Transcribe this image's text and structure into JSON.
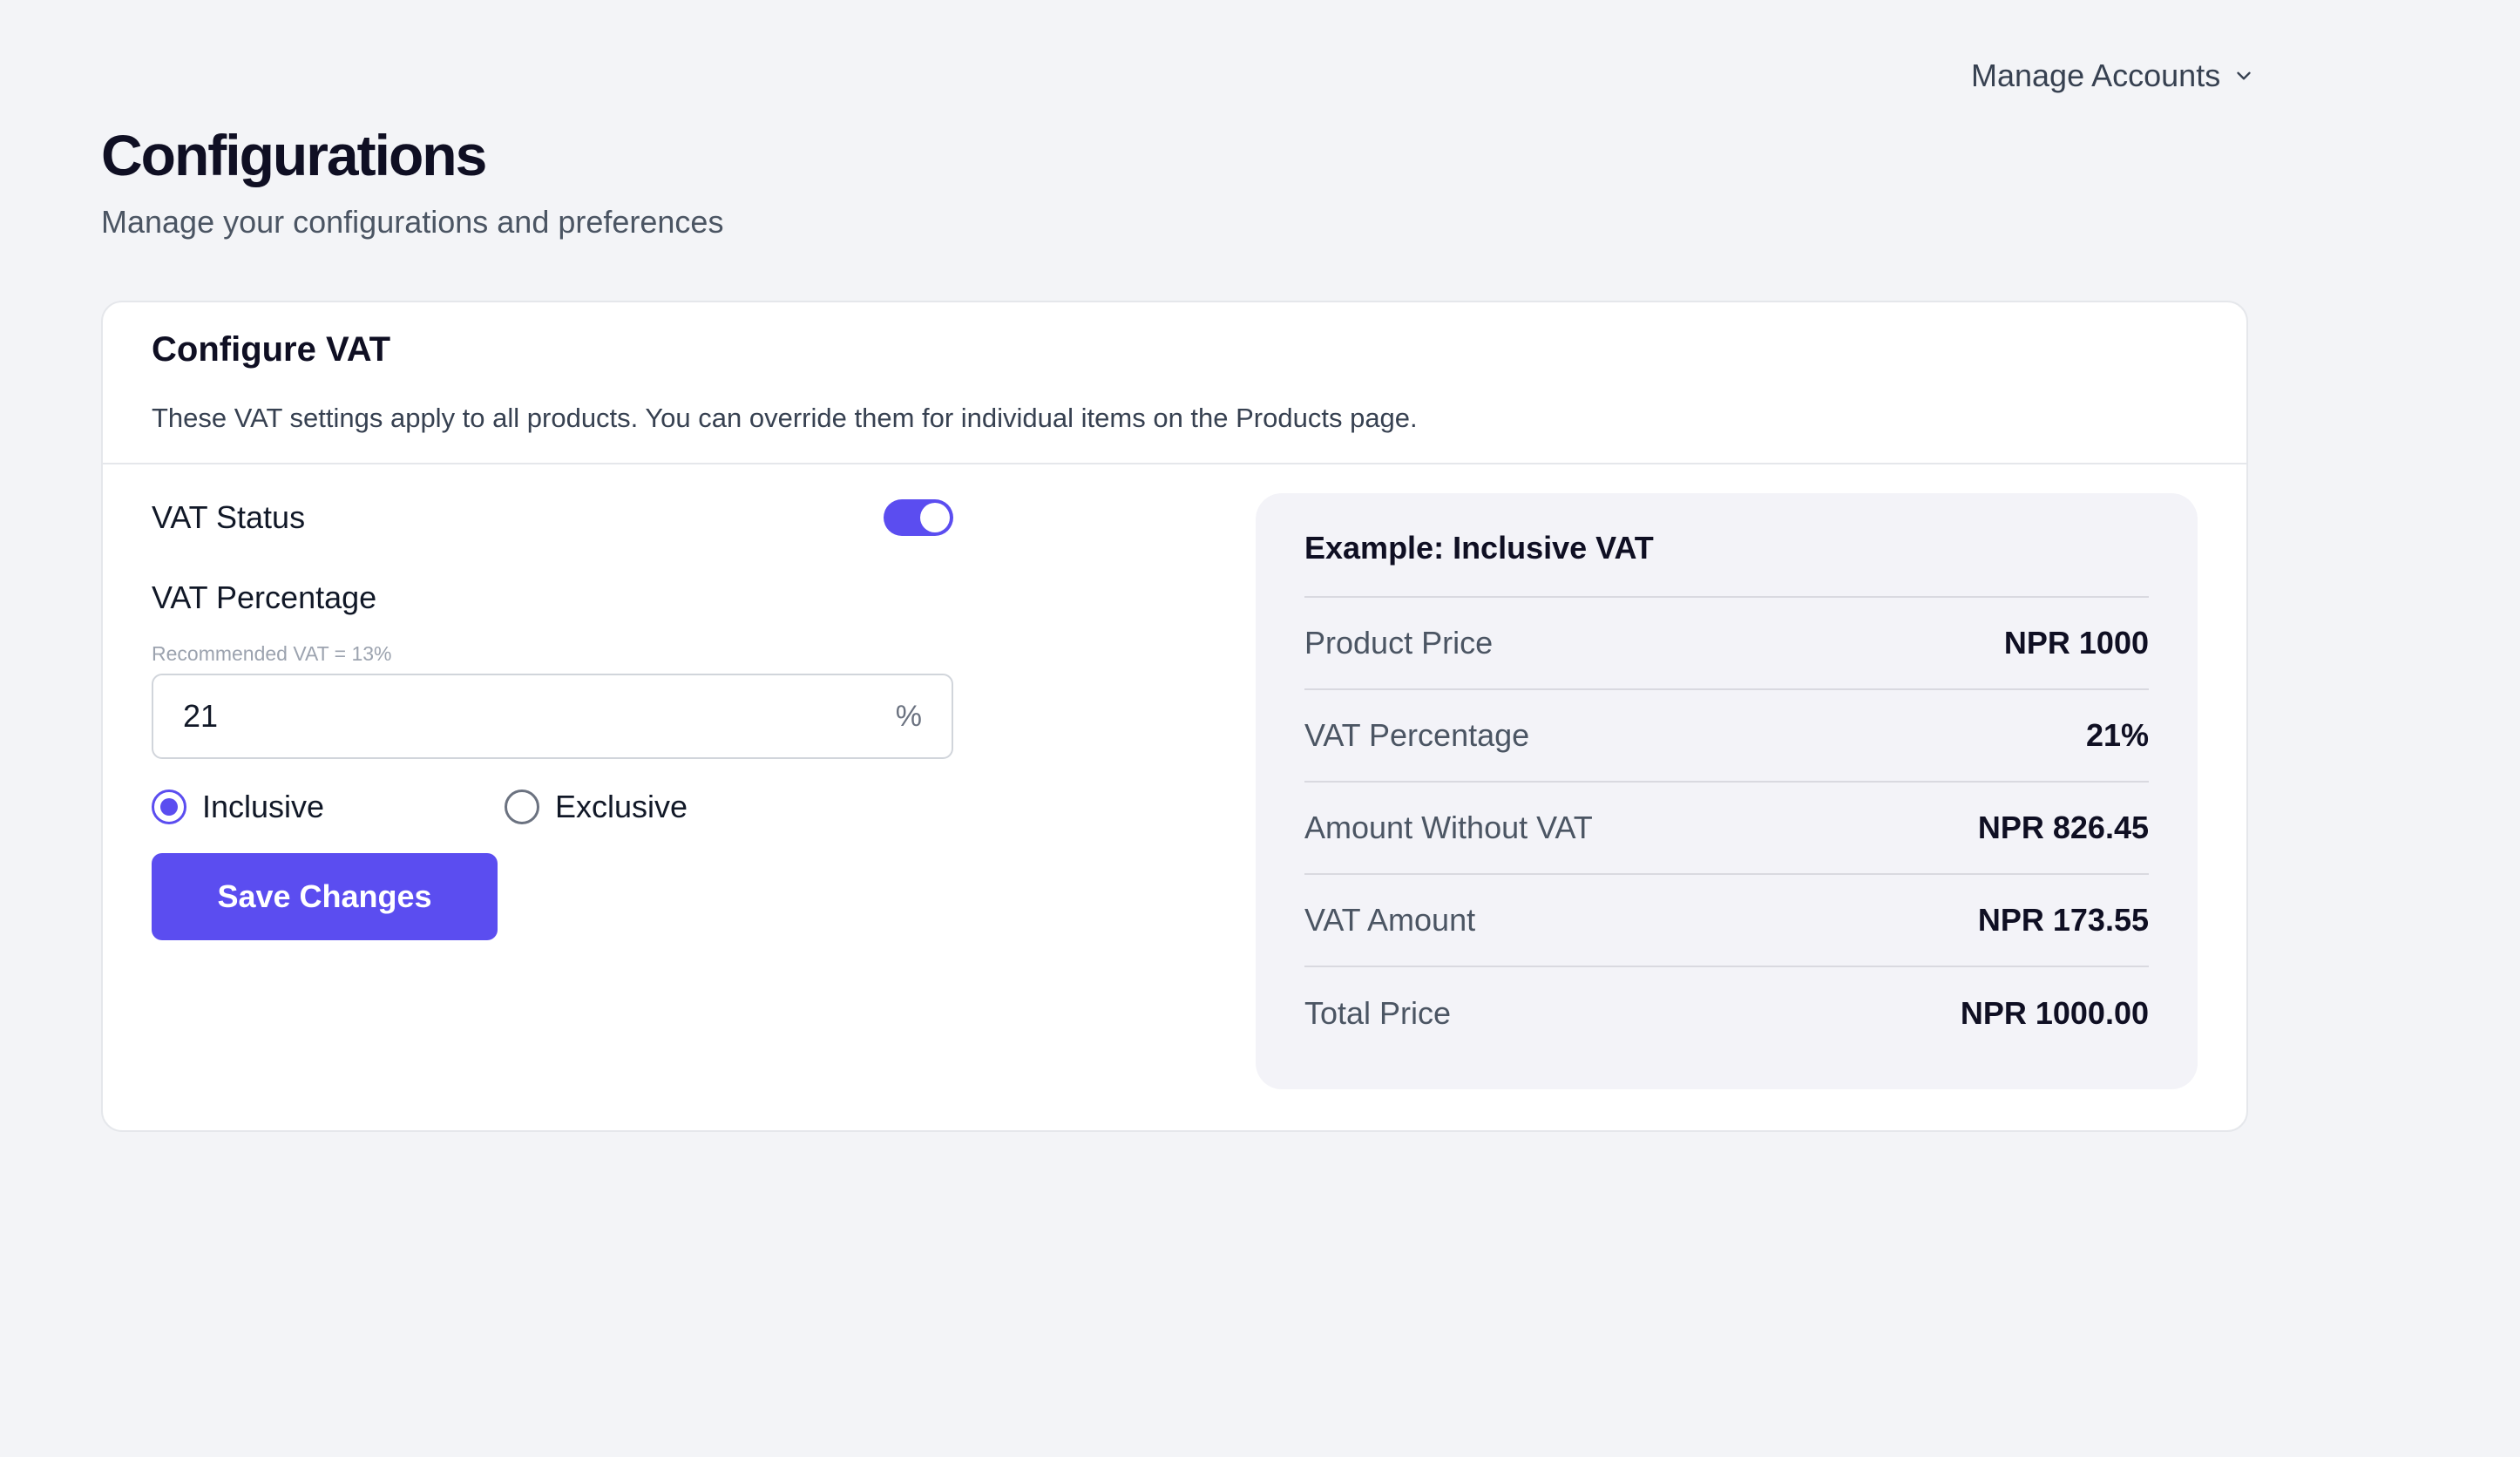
{
  "header": {
    "manage_accounts_label": "Manage Accounts",
    "title": "Configurations",
    "subtitle": "Manage your configurations and preferences"
  },
  "vat_card": {
    "title": "Configure VAT",
    "description": "These VAT settings apply to all products. You can override them for individual items on the Products page.",
    "status_label": "VAT Status",
    "status_enabled": true,
    "percentage_label": "VAT Percentage",
    "recommended_hint": "Recommended VAT = 13%",
    "percentage_value": "21",
    "percentage_suffix": "%",
    "options": [
      {
        "label": "Inclusive",
        "selected": true
      },
      {
        "label": "Exclusive",
        "selected": false
      }
    ],
    "save_label": "Save Changes"
  },
  "example": {
    "title": "Example: Inclusive VAT",
    "rows": [
      {
        "label": "Product Price",
        "value": "NPR 1000"
      },
      {
        "label": "VAT Percentage",
        "value": "21%"
      },
      {
        "label": "Amount Without VAT",
        "value": "NPR 826.45"
      },
      {
        "label": "VAT Amount",
        "value": "NPR 173.55"
      },
      {
        "label": "Total Price",
        "value": "NPR 1000.00"
      }
    ]
  },
  "colors": {
    "accent": "#5b4df0",
    "background": "#f3f4f7",
    "example_panel": "#f3f3f8"
  }
}
